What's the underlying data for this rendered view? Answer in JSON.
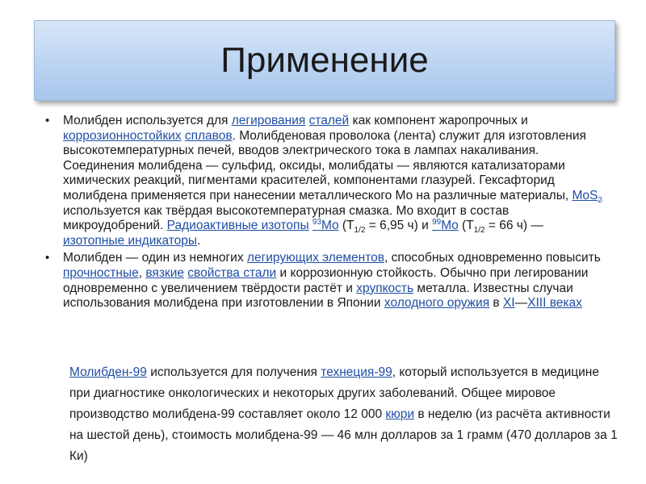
{
  "slide": {
    "title": "Применение"
  },
  "b1": {
    "t1": "Молибден используется для ",
    "l1": "легирования",
    "t2": " ",
    "l2": "сталей",
    "t3": " как компонент жаропрочных и ",
    "l3": "коррозионностойких",
    "t4": " ",
    "l4": "сплавов",
    "t5": ". Молибденовая проволока (лента) служит для изготовления высокотемпературных печей, вводов электрического тока в лампах накаливания. Соединения молибдена — сульфид, оксиды, молибдаты — являются катализаторами химических реакций, пигментами красителей, компонентами глазурей. Гексафторид молибдена применяется при нанесении металлического Mo на различные материалы, ",
    "l5_main": "MoS",
    "l5_sub": "2",
    "t6": " используется как твёрдая высокотемпературная смазка. Mo входит в состав микроудобрений. ",
    "l6": "Радиоактивные изотопы",
    "t7": " ",
    "l7_sup": "93",
    "l7_main": "Mo",
    "t8a": " (T",
    "t8_sub": "1/2",
    "t8b": " = 6,95 ч) и ",
    "l8_sup": "99",
    "l8_main": "Mo",
    "t9a": " (T",
    "t9_sub": "1/2",
    "t9b": " = 66 ч) — ",
    "l9": "изотопные индикаторы",
    "t10": "."
  },
  "b2": {
    "t1": "Молибден — один из немногих ",
    "l1": "легирующих элементов",
    "t2": ", способных одновременно повысить ",
    "l2": "прочностные",
    "t3": ", ",
    "l3": "вязкие",
    "t4": " ",
    "l4": "свойства стали",
    "t5": " и коррозионную стойкость. Обычно при легировании одновременно с увеличением твёрдости растёт и ",
    "l5": "хрупкость",
    "t6": " металла. Известны случаи использования молибдена при изготовлении в Японии ",
    "l6": "холодного оружия",
    "t7": " в ",
    "l7": "XI",
    "t8": "—",
    "l8": "XIII веках"
  },
  "note": {
    "l1": "Молибден-99",
    "t1": " используется для получения ",
    "l2": "технеция-99",
    "t2": ", который используется в медицине при диагностике онкологических и некоторых других заболеваний. Общее мировое производство молибдена-99 составляет около 12 000 ",
    "l3": "кюри",
    "t3": " в неделю (из расчёта активности на шестой день), стоимость молибдена-99 — 46 млн долларов за 1 грамм (470 долларов за 1 Ки)"
  },
  "colors": {
    "link": "#1f4ea5",
    "title_bg": "#b9d2f1"
  },
  "bullet_glyph": "•"
}
